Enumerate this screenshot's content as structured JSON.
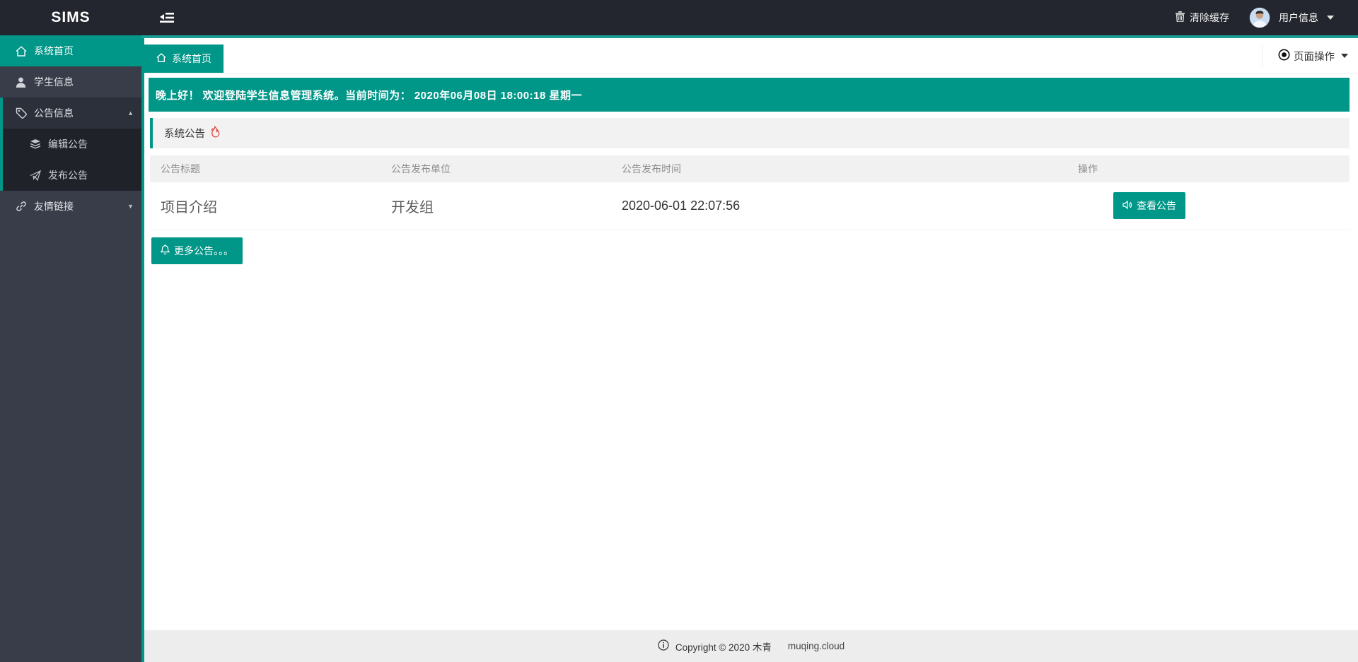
{
  "colors": {
    "primary": "#009688",
    "strip": "#1aa094",
    "topbar": "#23262E",
    "sidebar": "#393D49",
    "submenu": "#20222a",
    "footer_bg": "#ededed",
    "flame": "#e64340"
  },
  "topbar": {
    "logo": "SIMS",
    "clear_cache_label": "清除缓存",
    "user_info_label": "用户信息"
  },
  "sidebar": {
    "items": [
      {
        "label": "系统首页",
        "icon": "home-icon",
        "state": "active"
      },
      {
        "label": "学生信息",
        "icon": "user-icon"
      },
      {
        "label": "公告信息",
        "icon": "tag-icon",
        "state": "open-parent"
      },
      {
        "label": "编辑公告",
        "icon": "layers-icon",
        "sub": true
      },
      {
        "label": "发布公告",
        "icon": "send-icon",
        "sub": true
      },
      {
        "label": "友情链接",
        "icon": "link-icon",
        "state": "collapsed"
      }
    ]
  },
  "tabbar": {
    "active_tab": "系统首页",
    "page_actions_label": "页面操作"
  },
  "banner": {
    "text": "晚上好！ 欢迎登陆学生信息管理系统。当前时间为：  2020年06月08日 18:00:18   星期一"
  },
  "panel": {
    "title": "系统公告",
    "title_icon": "flame-icon"
  },
  "announcements": {
    "headers": [
      "公告标题",
      "公告发布单位",
      "公告发布时间",
      "操作"
    ],
    "rows": [
      {
        "title": "项目介绍",
        "unit": "开发组",
        "time": "2020-06-01 22:07:56",
        "action": "查看公告"
      }
    ],
    "more_label": "更多公告。。。"
  },
  "footer": {
    "copyright": "Copyright © 2020 木青",
    "domain": "muqing.cloud"
  }
}
